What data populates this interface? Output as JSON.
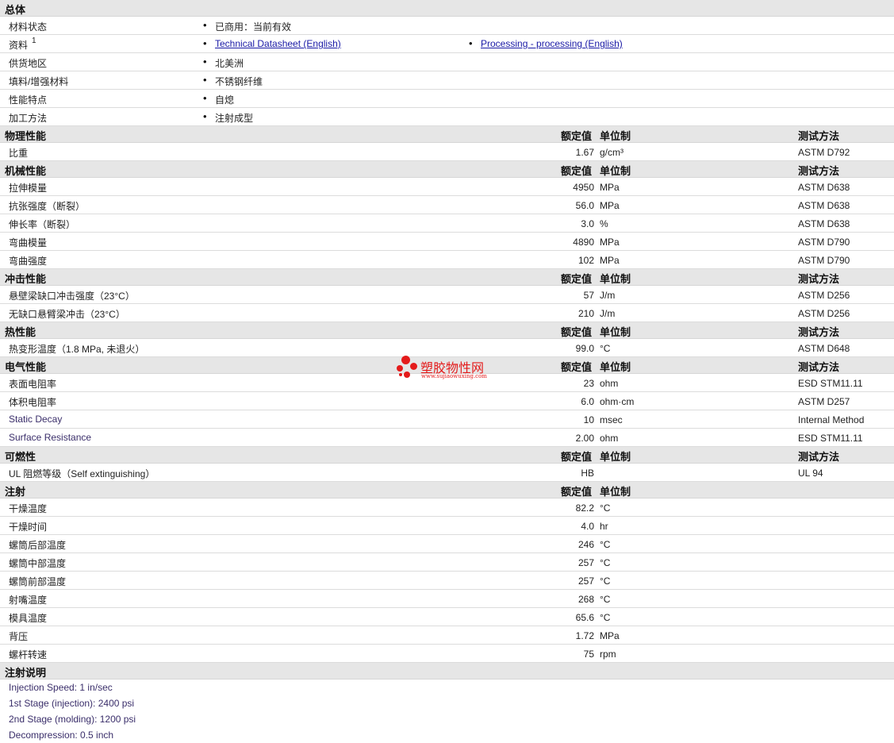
{
  "column_headers": {
    "nominal": "额定值",
    "unit": "单位制",
    "test": "测试方法"
  },
  "general": {
    "title": "总体",
    "rows": [
      {
        "label": "材料状态",
        "values": [
          "已商用：当前有效"
        ]
      },
      {
        "label": "资料",
        "sup": "1",
        "links": [
          "Technical Datasheet (English)",
          "Processing - processing (English)"
        ]
      },
      {
        "label": "供货地区",
        "values": [
          "北美洲"
        ]
      },
      {
        "label": "填料/增强材料",
        "values": [
          "不锈钢纤维"
        ]
      },
      {
        "label": "性能特点",
        "values": [
          "自熄"
        ]
      },
      {
        "label": "加工方法",
        "values": [
          "注射成型"
        ]
      }
    ]
  },
  "sections": [
    {
      "title": "物理性能",
      "show_test": true,
      "rows": [
        {
          "label": "比重",
          "value": "1.67",
          "unit": "g/cm³",
          "test": "ASTM D792"
        }
      ]
    },
    {
      "title": "机械性能",
      "show_test": true,
      "rows": [
        {
          "label": "拉伸模量",
          "value": "4950",
          "unit": "MPa",
          "test": "ASTM D638"
        },
        {
          "label": "抗张强度（断裂）",
          "value": "56.0",
          "unit": "MPa",
          "test": "ASTM D638"
        },
        {
          "label": "伸长率（断裂）",
          "value": "3.0",
          "unit": "%",
          "test": "ASTM D638"
        },
        {
          "label": "弯曲模量",
          "value": "4890",
          "unit": "MPa",
          "test": "ASTM D790"
        },
        {
          "label": "弯曲强度",
          "value": "102",
          "unit": "MPa",
          "test": "ASTM D790"
        }
      ]
    },
    {
      "title": "冲击性能",
      "show_test": true,
      "rows": [
        {
          "label": "悬壁梁缺口冲击强度（23°C）",
          "value": "57",
          "unit": "J/m",
          "test": "ASTM D256"
        },
        {
          "label": "无缺口悬臂梁冲击（23°C）",
          "value": "210",
          "unit": "J/m",
          "test": "ASTM D256"
        }
      ]
    },
    {
      "title": "热性能",
      "show_test": true,
      "rows": [
        {
          "label": "热变形温度（1.8 MPa, 未退火）",
          "value": "99.0",
          "unit": "°C",
          "test": "ASTM D648"
        }
      ]
    },
    {
      "title": "电气性能",
      "show_test": true,
      "rows": [
        {
          "label": "表面电阻率",
          "value": "23",
          "unit": "ohm",
          "test": "ESD STM11.11"
        },
        {
          "label": "体积电阻率",
          "value": "6.0",
          "unit": "ohm·cm",
          "test": "ASTM D257"
        },
        {
          "label": "Static Decay",
          "en": true,
          "value": "10",
          "unit": "msec",
          "test": "Internal Method"
        },
        {
          "label": "Surface Resistance",
          "en": true,
          "value": "2.00",
          "unit": "ohm",
          "test": "ESD STM11.11"
        }
      ]
    },
    {
      "title": "可燃性",
      "show_test": true,
      "rows": [
        {
          "label": "UL 阻燃等级（Self extinguishing）",
          "value": "HB",
          "unit": "",
          "test": "UL 94"
        }
      ]
    },
    {
      "title": "注射",
      "show_test": false,
      "rows": [
        {
          "label": "干燥温度",
          "value": "82.2",
          "unit": "°C",
          "test": ""
        },
        {
          "label": "干燥时间",
          "value": "4.0",
          "unit": "hr",
          "test": ""
        },
        {
          "label": "螺筒后部温度",
          "value": "246",
          "unit": "°C",
          "test": ""
        },
        {
          "label": "螺筒中部温度",
          "value": "257",
          "unit": "°C",
          "test": ""
        },
        {
          "label": "螺筒前部温度",
          "value": "257",
          "unit": "°C",
          "test": ""
        },
        {
          "label": "射嘴温度",
          "value": "268",
          "unit": "°C",
          "test": ""
        },
        {
          "label": "模具温度",
          "value": "65.6",
          "unit": "°C",
          "test": ""
        },
        {
          "label": "背压",
          "value": "1.72",
          "unit": "MPa",
          "test": ""
        },
        {
          "label": "螺杆转速",
          "value": "75",
          "unit": "rpm",
          "test": ""
        }
      ]
    }
  ],
  "injection_notes": {
    "title": "注射说明",
    "lines": [
      "Injection Speed: 1 in/sec",
      "1st Stage (injection): 2400 psi",
      "2nd Stage (molding): 1200 psi",
      "Decompression: 0.5 inch"
    ]
  },
  "watermark": {
    "name": "塑胶物性网",
    "url": "www.sujiaowuxing.com",
    "color": "#e41b1b"
  }
}
